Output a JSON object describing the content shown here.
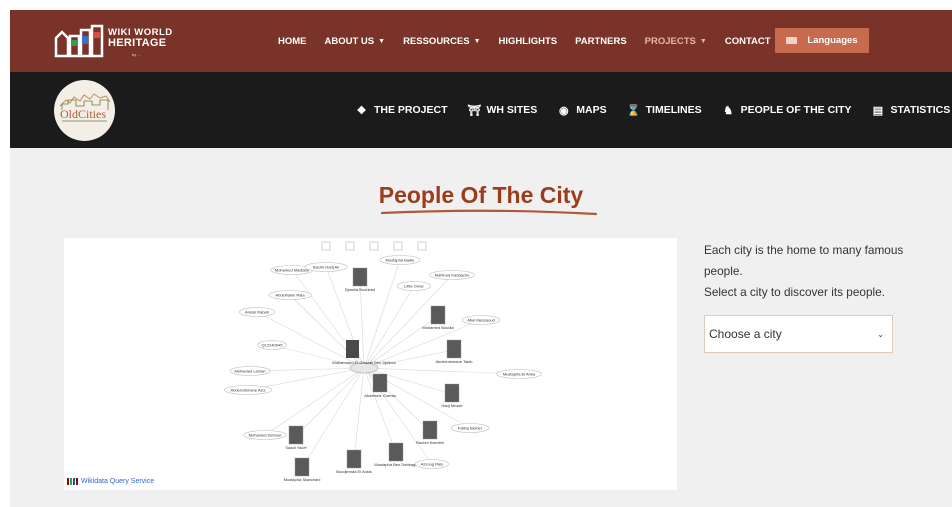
{
  "header": {
    "logo": {
      "line1": "WIKI WORLD",
      "line2": "HERITAGE",
      "sub": "by ..."
    },
    "nav": [
      {
        "label": "HOME",
        "chevron": false,
        "active": false
      },
      {
        "label": "ABOUT US",
        "chevron": true,
        "active": false
      },
      {
        "label": "RESSOURCES",
        "chevron": true,
        "active": false
      },
      {
        "label": "HIGHLIGHTS",
        "chevron": false,
        "active": false
      },
      {
        "label": "PARTNERS",
        "chevron": false,
        "active": false
      },
      {
        "label": "PROJECTS",
        "chevron": true,
        "active": true
      },
      {
        "label": "CONTACT",
        "chevron": false,
        "active": false
      }
    ],
    "languages_label": "Languages"
  },
  "subheader": {
    "logo_text": "OldCities",
    "nav": [
      {
        "label": "THE PROJECT",
        "icon": "info-icon"
      },
      {
        "label": "WH SITES",
        "icon": "monument-icon"
      },
      {
        "label": "MAPS",
        "icon": "globe-icon"
      },
      {
        "label": "TIMELINES",
        "icon": "hourglass-icon"
      },
      {
        "label": "PEOPLE OF THE CITY",
        "icon": "users-icon"
      },
      {
        "label": "STATISTICS",
        "icon": "chart-icon"
      }
    ]
  },
  "main": {
    "title": "People Of The City",
    "intro_line1": "Each city is the home to many famous people.",
    "intro_line2": "Select a city to discover its people.",
    "city_select": {
      "value": "Choose a city"
    },
    "graph": {
      "credit": "Wikidata Query Service",
      "center": "Mohammed El-Ghazali Ben Djelloul",
      "nodes": [
        "Mohamed Madiane",
        "Bachir Hadj Ali",
        "Mustapha Badie",
        "Mahfoud Kaddache",
        "Little Omar",
        "Abdelhalim Raia",
        "Djamila Bouhired",
        "Aréski Rabah",
        "Mohamed Boudia",
        "Abel Messaoud",
        "Q12240945",
        "Mohamed Lamari",
        "Abderrahmane Taleb",
        "Mustapha El Anka",
        "Abderrahmane Aziz",
        "Abdelaziz Guenta",
        "Hadj Mrizek",
        "Fatiha Berber",
        "Mohamed Zerbout",
        "Rachid Ksentini",
        "Saadi Yacef",
        "Boudjemaa El Ankis",
        "Mustapha Ben Debbagh",
        "Azzoug Rais",
        "Mustapha Skandrani"
      ]
    }
  }
}
